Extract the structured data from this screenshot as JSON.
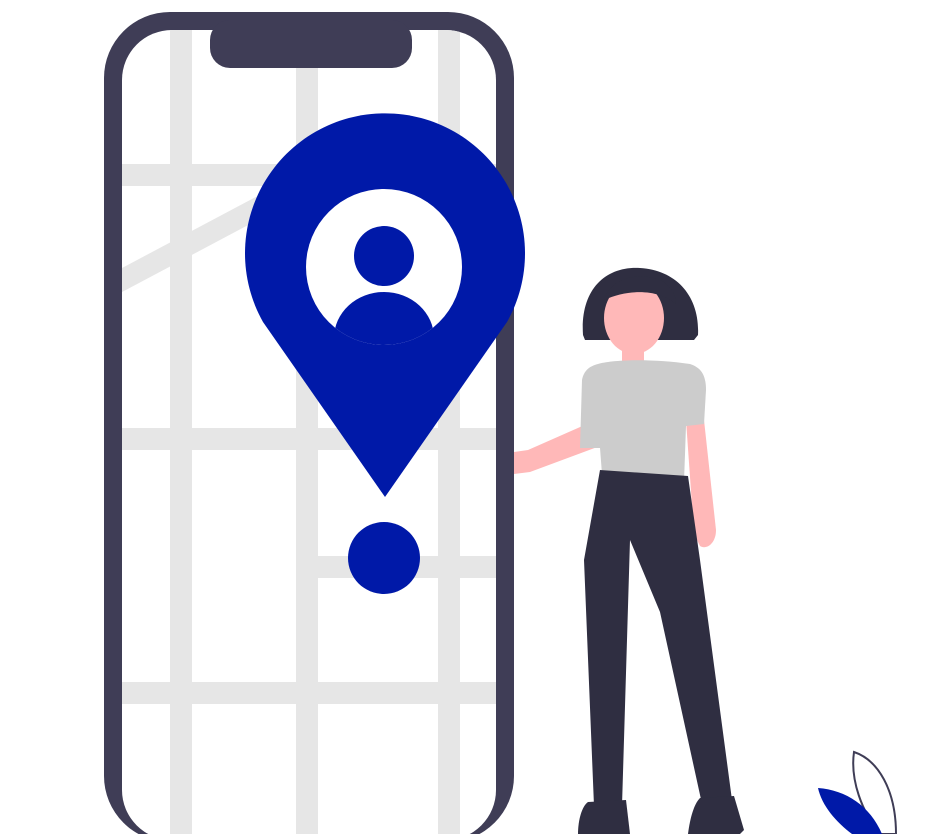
{
  "illustration": {
    "subject": "",
    "colors": {
      "phone_frame": "#3f3d56",
      "map_background": "#ffffff",
      "map_roads": "#e6e6e6",
      "pin": "#0019a8",
      "pin_cutout": "#ffffff",
      "skin": "#ffb8b8",
      "hair": "#2f2e41",
      "shirt": "#cccccc",
      "pants": "#2f2e41",
      "shoes": "#2f2e41",
      "leaf_fill": "#0019a8",
      "leaf_outline": "#3f3d56"
    },
    "icons": [
      "location-pin-icon",
      "user-avatar-icon"
    ]
  }
}
